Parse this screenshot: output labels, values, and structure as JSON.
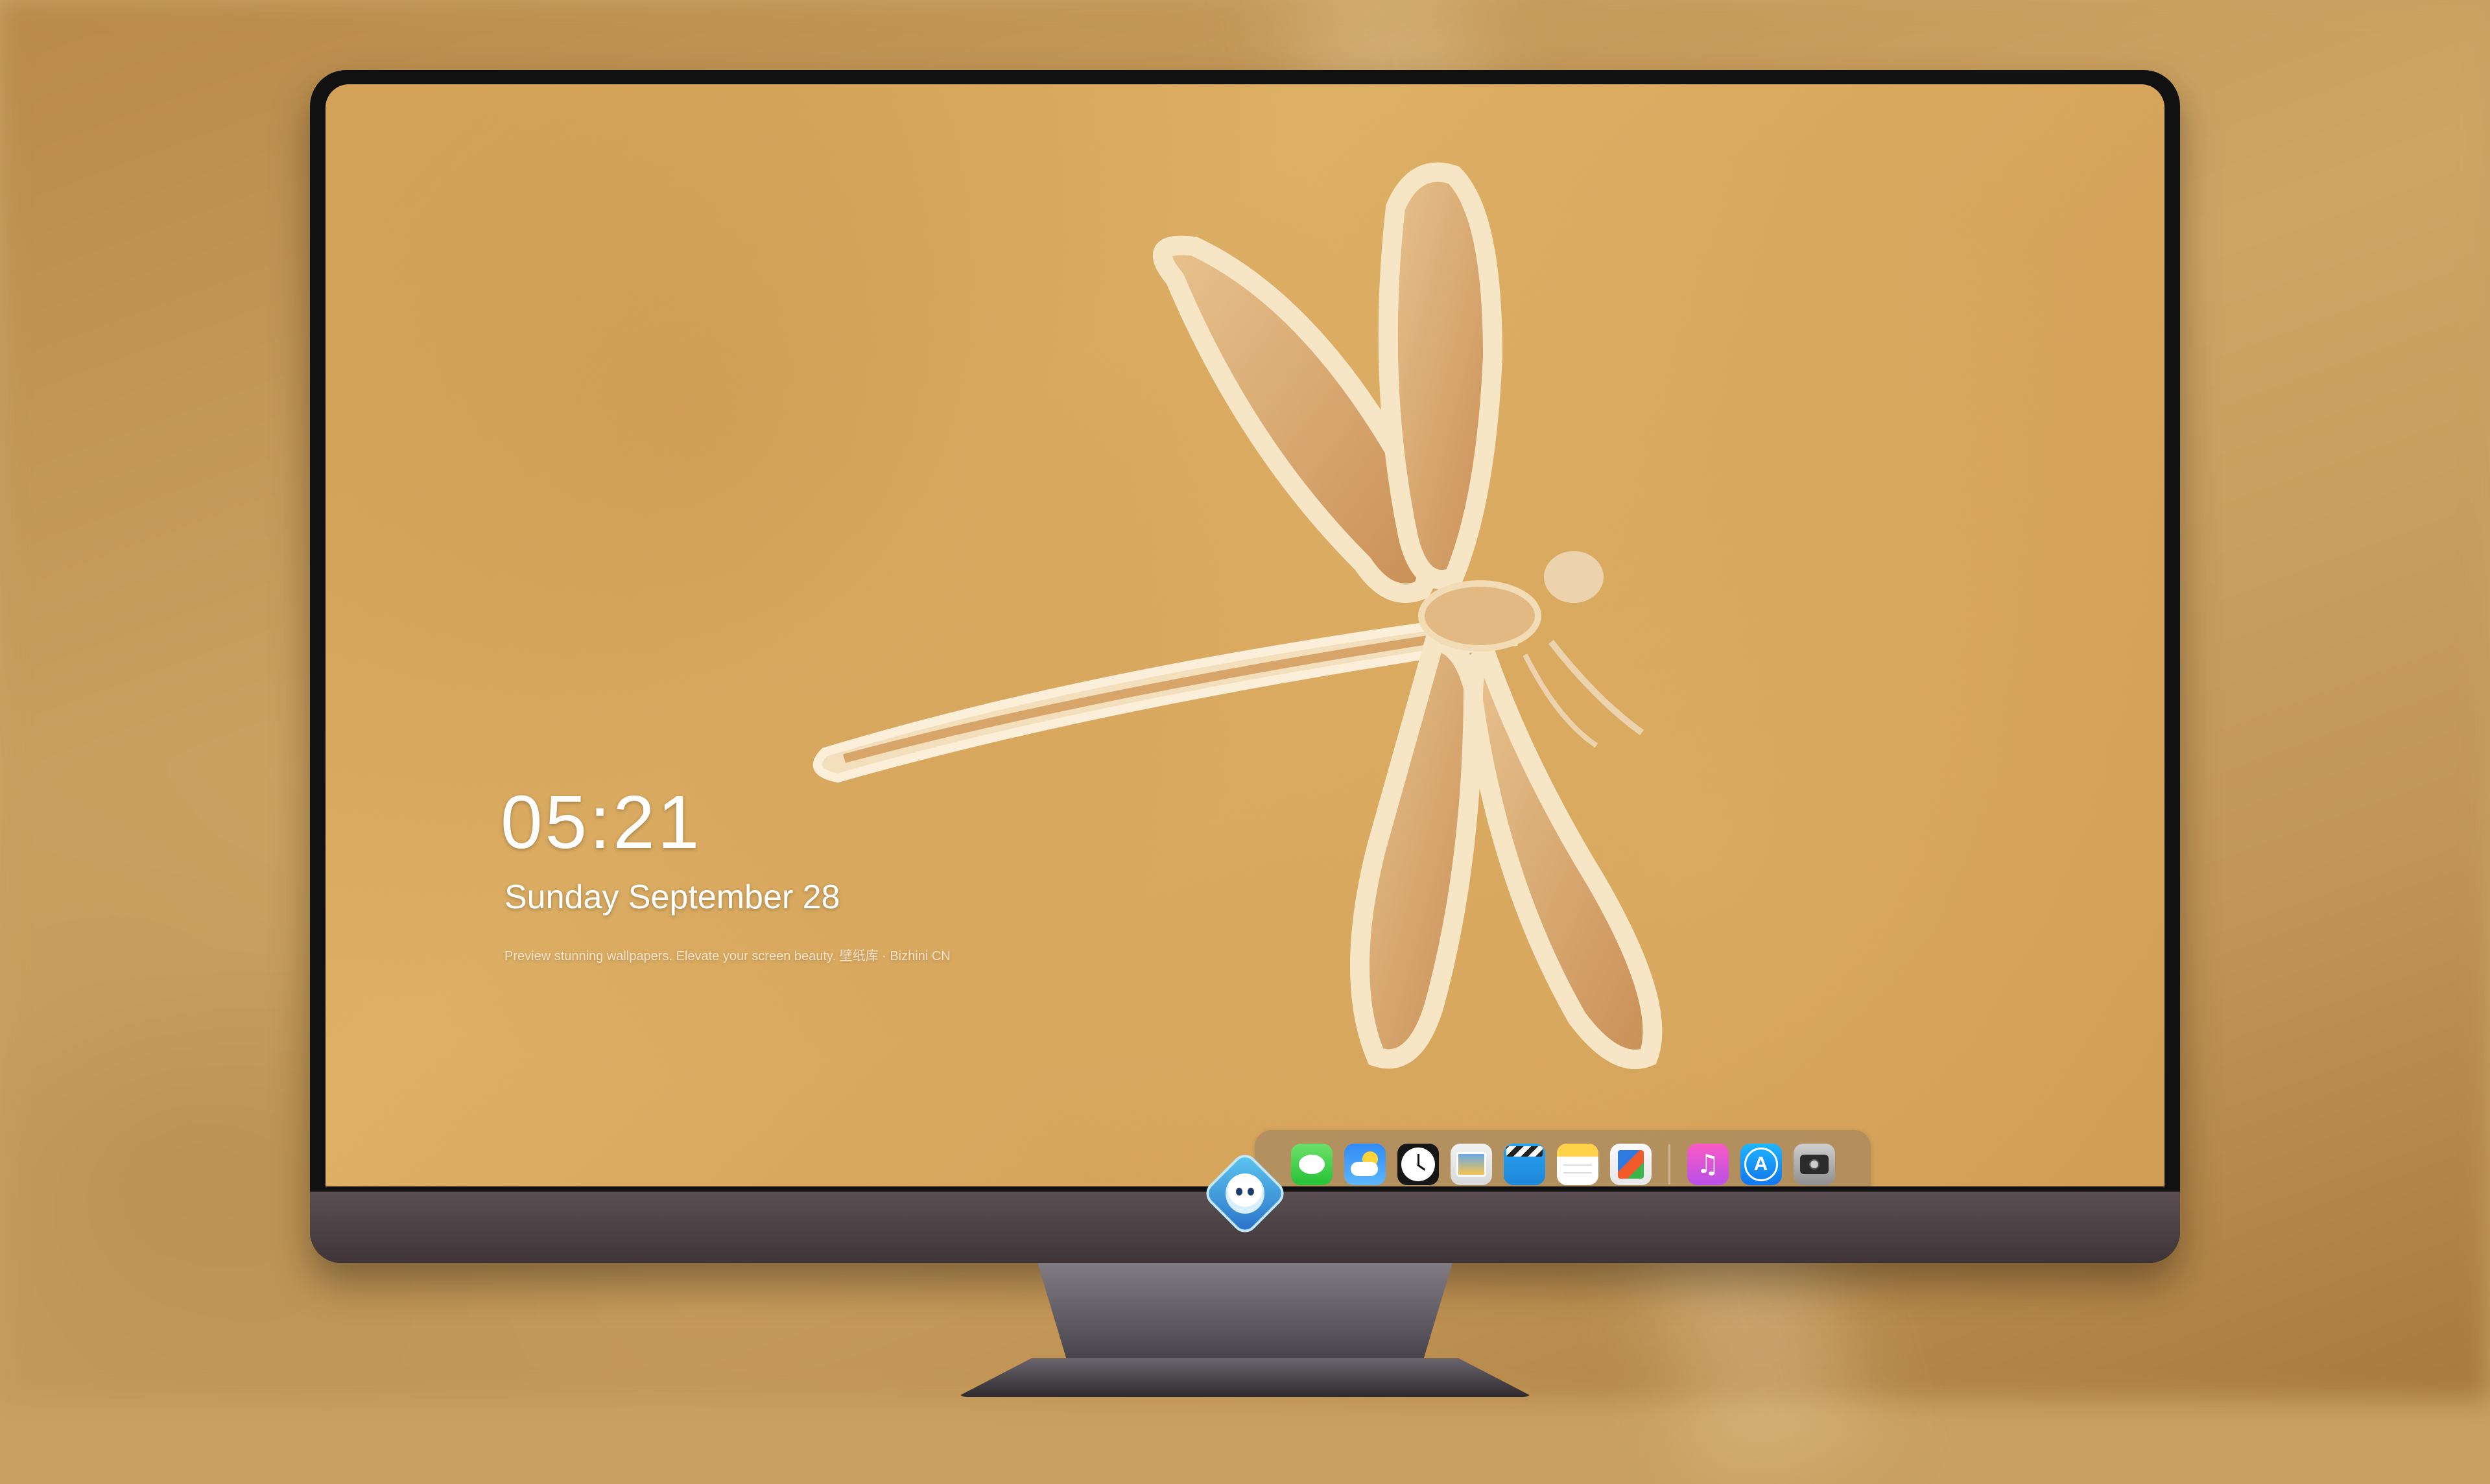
{
  "lock_screen": {
    "time": "05:21",
    "date": "Sunday September  28",
    "tagline": "Preview stunning wallpapers. Elevate your screen beauty. 壁纸库 · Bizhini CN"
  },
  "dock": {
    "apps": [
      {
        "name": "Messages",
        "icon": "message-bubble-icon",
        "color": "#34c759"
      },
      {
        "name": "Weather",
        "icon": "weather-icon",
        "color": "#2f8bf3"
      },
      {
        "name": "Clock",
        "icon": "clock-icon",
        "color": "#161616"
      },
      {
        "name": "Preview",
        "icon": "preview-icon",
        "color": "#e6e6e6"
      },
      {
        "name": "Clips",
        "icon": "clapperboard-icon",
        "color": "#29a4f2"
      },
      {
        "name": "Notes",
        "icon": "notes-icon",
        "color": "#ffd24a"
      },
      {
        "name": "Office",
        "icon": "office-document-icon",
        "color": "#2d7be0"
      },
      {
        "name": "Music",
        "icon": "music-note-icon",
        "color": "#fb5bc5"
      },
      {
        "name": "App Store",
        "icon": "app-store-icon",
        "color": "#1176f0"
      },
      {
        "name": "Camera",
        "icon": "camera-icon",
        "color": "#8f8f8f"
      }
    ]
  },
  "glyphs": {
    "music": "♫",
    "appstore": "A"
  },
  "colors": {
    "wallpaper": "#dba75c",
    "bezel": "#111111",
    "chin": "#4a4044"
  }
}
